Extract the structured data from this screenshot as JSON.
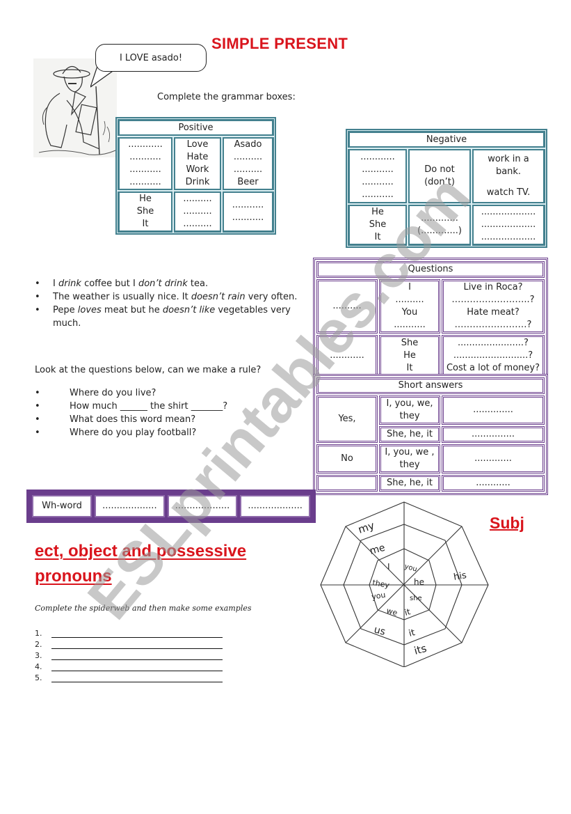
{
  "title": "SIMPLE PRESENT",
  "speech_bubble": "I LOVE asado!",
  "instruction": "Complete the grammar boxes:",
  "positive_table": {
    "header": "Positive",
    "row1": {
      "subjects": "............\n...........\n...........\n...........",
      "verbs": [
        "Love",
        "Hate",
        "Work",
        "Drink"
      ],
      "objects": [
        "Asado",
        "..........",
        "..........",
        "Beer"
      ]
    },
    "row2": {
      "subjects": [
        "He",
        "She",
        "It"
      ],
      "verbs": [
        "..........",
        "..........",
        ".........."
      ],
      "objects": [
        "...........",
        "..........."
      ]
    },
    "dots_long": "............",
    "dots_mid": "..........."
  },
  "negative_table": {
    "header": "Negative",
    "row1": {
      "subjects": [
        "............",
        "...........",
        "...........",
        "..........."
      ],
      "aux": [
        "Do not",
        "(don’t)"
      ],
      "complements": [
        "work in a bank.",
        "watch TV."
      ]
    },
    "row2": {
      "subjects": [
        "He",
        "She",
        "It"
      ],
      "aux": [
        ".............",
        "(.............)"
      ],
      "complements": [
        "...................",
        "...................",
        "..................."
      ]
    }
  },
  "examples": [
    {
      "parts": [
        {
          "t": "I "
        },
        {
          "t": "drink",
          "i": true
        },
        {
          "t": " coffee but I "
        },
        {
          "t": "don’t drink",
          "i": true
        },
        {
          "t": " tea."
        }
      ]
    },
    {
      "parts": [
        {
          "t": "The weather is usually nice. It "
        },
        {
          "t": "doesn’t rain",
          "i": true
        },
        {
          "t": " very often."
        }
      ]
    },
    {
      "parts": [
        {
          "t": "Pepe "
        },
        {
          "t": "loves",
          "i": true
        },
        {
          "t": " meat but he "
        },
        {
          "t": "doesn’t like",
          "i": true
        },
        {
          "t": " vegetables very much."
        }
      ]
    }
  ],
  "rule_question": "Look at the questions below, can we make a rule?",
  "questions_list": [
    "Where do you live?",
    "How much ______ the shirt  _______?",
    "What does this word mean?",
    "Where do you play football?"
  ],
  "questions_table": {
    "header": "Questions",
    "row1": {
      "aux": "..........",
      "subjects": [
        "I",
        "..........",
        "You",
        "..........."
      ],
      "verbs": [
        "Live in Roca?",
        "……………………..?",
        "Hate meat?",
        "……………………?"
      ]
    },
    "row2": {
      "aux": "............",
      "subjects": [
        "She",
        "He",
        "It"
      ],
      "verbs": [
        ".......................?",
        "..........................?",
        "Cost a lot of money?"
      ]
    }
  },
  "short_answers": {
    "header": "Short answers",
    "rows": [
      {
        "answer": "Yes,",
        "subject": "I, you, we, they",
        "blank": ".............."
      },
      {
        "answer": "",
        "subject": "She, he, it",
        "blank": "..............."
      },
      {
        "answer": "No",
        "subject": "I, you, we , they",
        "blank": "............."
      },
      {
        "answer": "",
        "subject": "She, he, it",
        "blank": "............"
      }
    ]
  },
  "wh_table": {
    "label": "Wh-word",
    "blanks": [
      "...................",
      "...................",
      "..................."
    ]
  },
  "pronouns_heading": {
    "line1": "ect, object and possessive",
    "line2": "pronouns",
    "side": "Subj"
  },
  "cursive_instruction": "Complete the spiderweb and then make some examples",
  "example_lines": [
    "1.",
    "2.",
    "3.",
    "4.",
    "5."
  ],
  "spiderweb_words": {
    "inner": [
      "I",
      "you",
      "he",
      "she",
      "it",
      "we",
      "you",
      "they"
    ],
    "middle": [
      "me",
      "us",
      "it"
    ],
    "outer": [
      "my",
      "his",
      "its"
    ]
  },
  "watermark": "ESLprintables.com",
  "colors": {
    "title_red": "#d9141c",
    "teal_border": "#43808e",
    "purple_border": "#6a3d8c",
    "watermark_gray": "#b0b0b0"
  }
}
